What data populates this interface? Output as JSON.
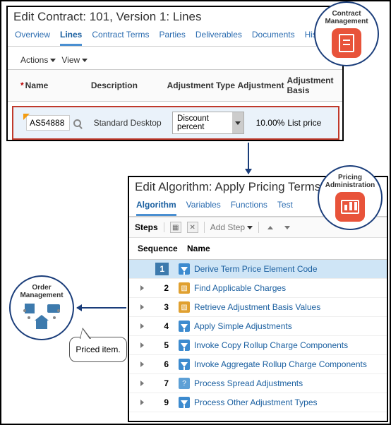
{
  "contract": {
    "title": "Edit Contract: 101, Version 1: Lines",
    "tabs": [
      "Overview",
      "Lines",
      "Contract Terms",
      "Parties",
      "Deliverables",
      "Documents",
      "History"
    ],
    "active_tab": 1,
    "actions_label": "Actions",
    "view_label": "View",
    "columns": {
      "name": "Name",
      "description": "Description",
      "adj_type": "Adjustment Type",
      "adjustment": "Adjustment",
      "adj_basis": "Adjustment Basis"
    },
    "row": {
      "name": "AS54888",
      "description": "Standard Desktop",
      "adj_type": "Discount percent",
      "adjustment": "10.00%",
      "adj_basis": "List price"
    }
  },
  "pricing": {
    "title": "Edit Algorithm: Apply Pricing Terms",
    "tabs": [
      "Algorithm",
      "Variables",
      "Functions",
      "Test"
    ],
    "active_tab": 0,
    "steps_label": "Steps",
    "add_step_label": "Add Step",
    "columns": {
      "sequence": "Sequence",
      "name": "Name"
    },
    "steps": [
      {
        "seq": "1",
        "name": "Derive Term Price Element Code",
        "icon": "funnel",
        "selected": true
      },
      {
        "seq": "2",
        "name": "Find Applicable Charges",
        "icon": "box"
      },
      {
        "seq": "3",
        "name": "Retrieve Adjustment Basis Values",
        "icon": "box"
      },
      {
        "seq": "4",
        "name": "Apply Simple Adjustments",
        "icon": "funnel"
      },
      {
        "seq": "5",
        "name": "Invoke Copy Rollup Charge Components",
        "icon": "funnel"
      },
      {
        "seq": "6",
        "name": "Invoke Aggregate Rollup Charge Components",
        "icon": "funnel"
      },
      {
        "seq": "7",
        "name": "Process Spread Adjustments",
        "icon": "question"
      },
      {
        "seq": "9",
        "name": "Process Other Adjustment Types",
        "icon": "funnel"
      }
    ]
  },
  "badges": {
    "cm": "Contract Management",
    "pa": "Pricing Administration",
    "om": "Order Management"
  },
  "callout": "Priced item."
}
